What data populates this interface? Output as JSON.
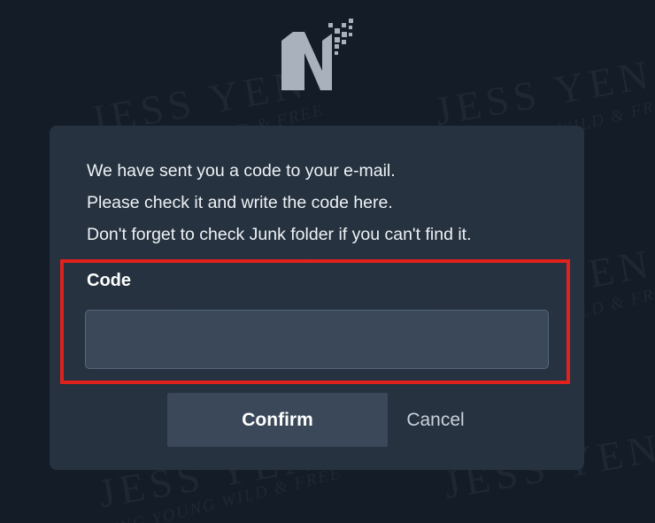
{
  "dialog": {
    "message_lines": [
      "We have sent you a code to your e-mail.",
      "Please check it and write the code here.",
      "Don't forget to check Junk folder if you can't find it."
    ],
    "code_label": "Code",
    "code_value": "",
    "confirm_label": "Confirm",
    "cancel_label": "Cancel"
  },
  "watermark": {
    "brand": "JESS YEN",
    "tagline": "LIVING YOUNG WILD & FREE"
  },
  "logo": {
    "letter": "N"
  },
  "colors": {
    "background": "#141c27",
    "card": "#283442",
    "input": "#3a4859",
    "highlight": "#e0211e",
    "logo": "#a9b2bc"
  }
}
